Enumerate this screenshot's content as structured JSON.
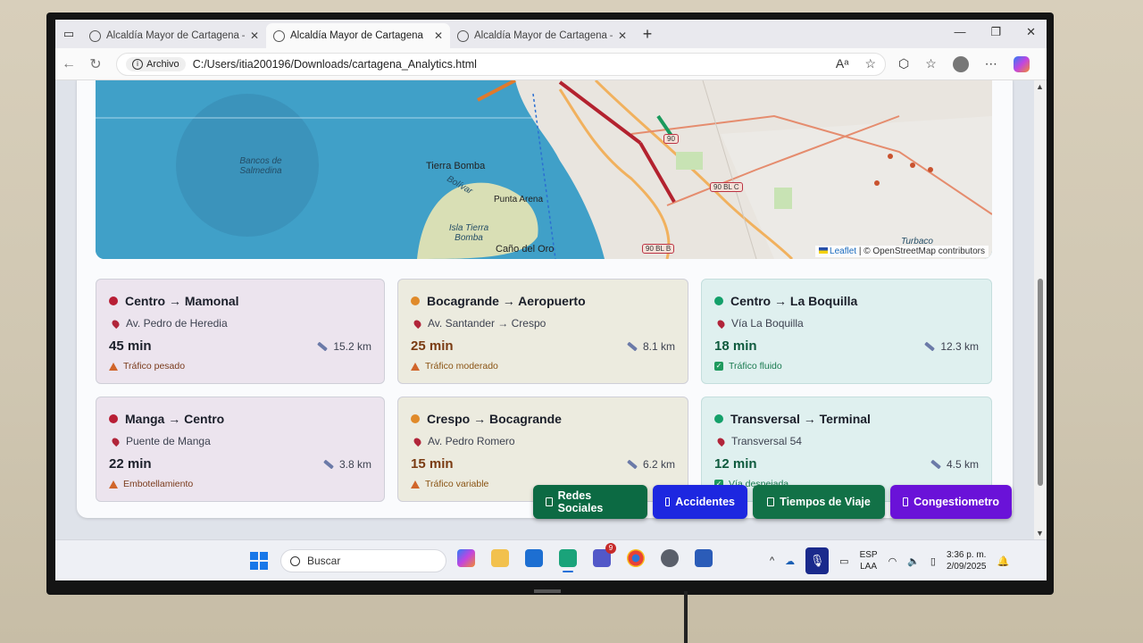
{
  "browser": {
    "tabs": [
      {
        "label": "Alcaldía Mayor de Cartagena — D",
        "active": false
      },
      {
        "label": "Alcaldía Mayor de Cartagena",
        "active": true
      },
      {
        "label": "Alcaldía Mayor de Cartagena — D",
        "active": false
      }
    ],
    "new_tab": "+",
    "address": {
      "chip_label": "Archivo",
      "url": "C:/Users/itia200196/Downloads/cartagena_Analytics.html"
    }
  },
  "map": {
    "labels": {
      "bancos": "Bancos de Salmedina",
      "tierra_bomba": "Tierra Bomba",
      "bolivar": "Bolívar",
      "punta_arena": "Punta Arena",
      "isla": "Isla Tierra Bomba",
      "cano": "Caño del Oro",
      "turbaco": "Turbaco"
    },
    "shields": {
      "s90": "90",
      "s90blc": "90 BL C",
      "s90blb": "90 BL B"
    },
    "attribution": {
      "leaflet": "Leaflet",
      "rest": "| © OpenStreetMap contributors"
    }
  },
  "routes": [
    {
      "title": "Centro → Mamonal",
      "street": "Av. Pedro de Heredia",
      "time": "45 min",
      "distance": "15.2 km",
      "status": "Tráfico pesado",
      "level": "red"
    },
    {
      "title": "Bocagrande → Aeropuerto",
      "street": "Av. Santander → Crespo",
      "time": "25 min",
      "distance": "8.1 km",
      "status": "Tráfico moderado",
      "level": "orange"
    },
    {
      "title": "Centro → La Boquilla",
      "street": "Vía La Boquilla",
      "time": "18 min",
      "distance": "12.3 km",
      "status": "Tráfico fluido",
      "level": "green"
    },
    {
      "title": "Manga → Centro",
      "street": "Puente de Manga",
      "time": "22 min",
      "distance": "3.8 km",
      "status": "Embotellamiento",
      "level": "red"
    },
    {
      "title": "Crespo → Bocagrande",
      "street": "Av. Pedro Romero",
      "time": "15 min",
      "distance": "6.2 km",
      "status": "Tráfico variable",
      "level": "orange"
    },
    {
      "title": "Transversal → Terminal",
      "street": "Transversal 54",
      "time": "12 min",
      "distance": "4.5 km",
      "status": "Vía despejada",
      "level": "green"
    }
  ],
  "floating_nav": {
    "social": "Redes Sociales",
    "accidents": "Accidentes",
    "travel": "Tiempos de Viaje",
    "congestion": "Congestiometro"
  },
  "taskbar": {
    "search_placeholder": "Buscar",
    "teams_badge": "9",
    "lang_line1": "ESP",
    "lang_line2": "LAA",
    "time": "3:36 p. m.",
    "date": "2/09/2025"
  },
  "colors": {
    "red": "#b81e35",
    "orange": "#e08a2a",
    "green": "#14a06a",
    "social_btn": "#0c6a43",
    "accidents_btn": "#1d27e0",
    "travel_btn": "#127147",
    "congestion_btn": "#6a12d8"
  }
}
